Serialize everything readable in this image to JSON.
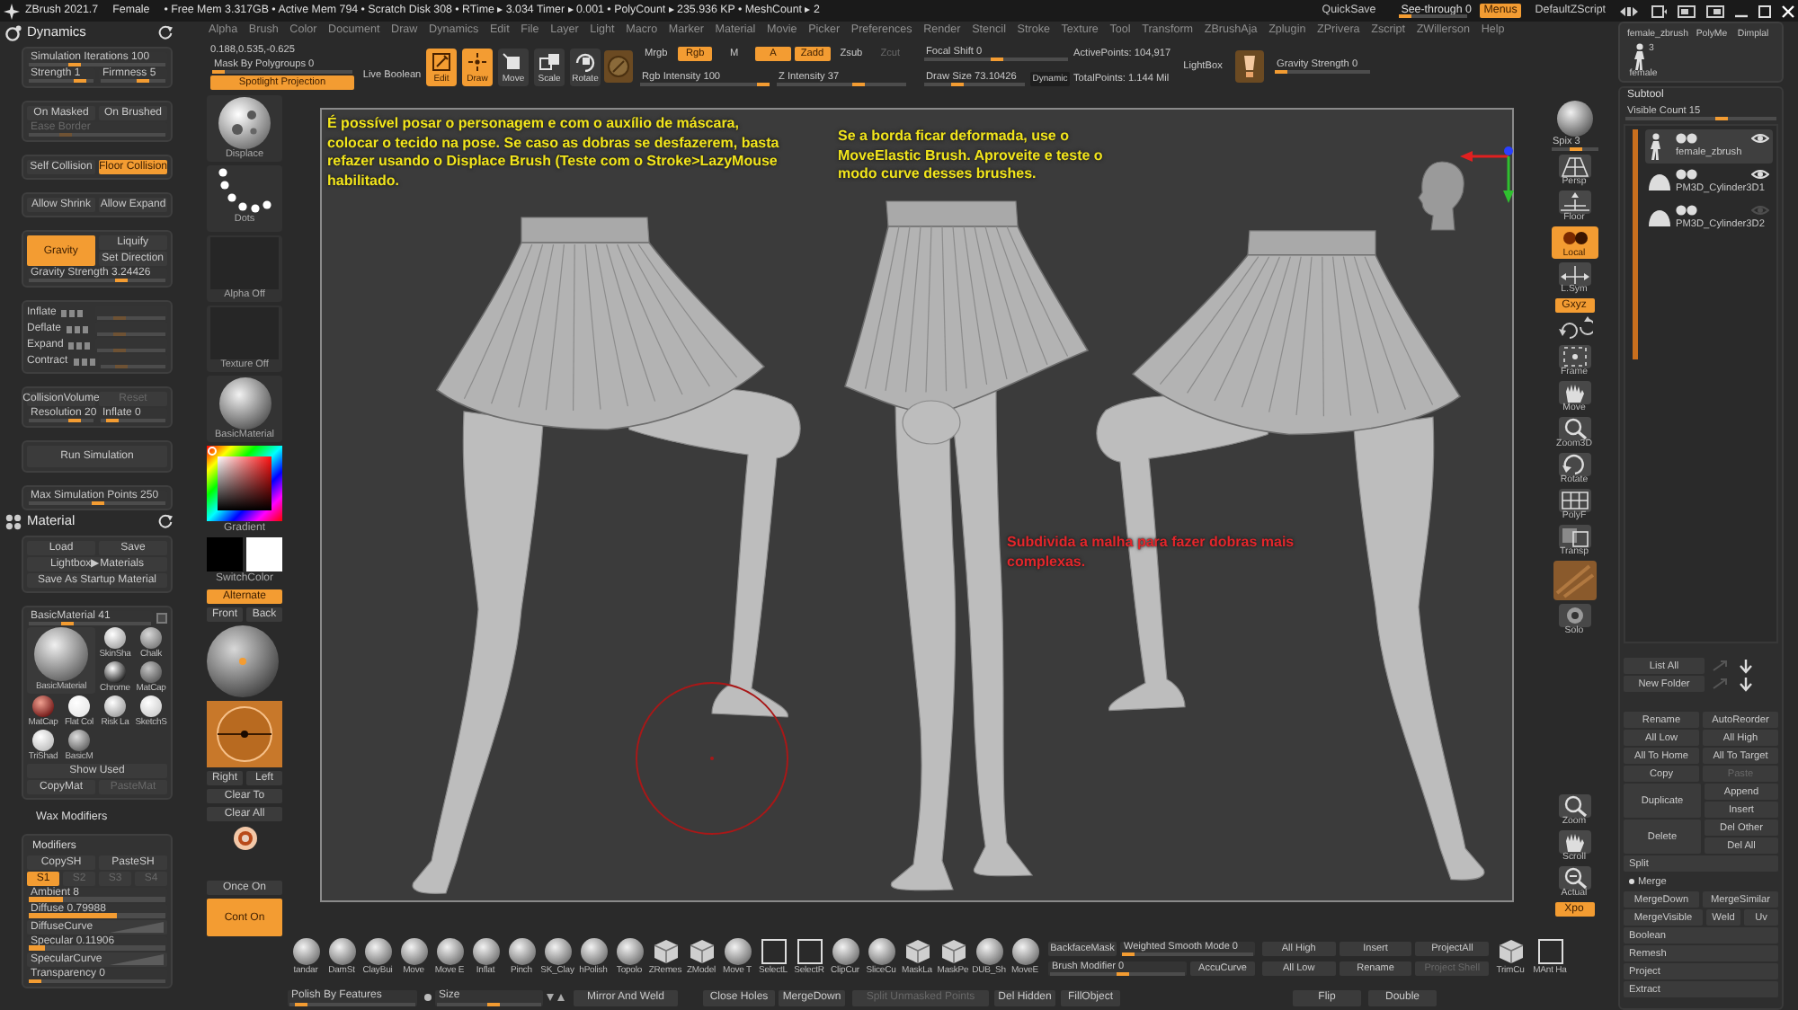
{
  "title_bar": {
    "app": "ZBrush 2021.7",
    "document": "Female",
    "stats": "• Free Mem 3.317GB • Active Mem 794 • Scratch Disk 308 • RTime ▸ 3.034 Timer ▸ 0.001 • PolyCount ▸ 235.936 KP • MeshCount ▸ 2",
    "controls": [
      {
        "kind": "button",
        "label": "QuickSave",
        "on": false
      },
      {
        "kind": "slider",
        "label": "See-through 0",
        "level": 0
      },
      {
        "kind": "button",
        "label": "Menus",
        "on": true
      },
      {
        "kind": "button",
        "label": "DefaultZScript",
        "on": false
      }
    ]
  },
  "menu": [
    "Alpha",
    "Brush",
    "Color",
    "Document",
    "Draw",
    "Dynamics",
    "Edit",
    "File",
    "Layer",
    "Light",
    "Macro",
    "Marker",
    "Material",
    "Movie",
    "Picker",
    "Preferences",
    "Render",
    "Stencil",
    "Stroke",
    "Texture",
    "Tool",
    "Transform",
    "ZBrushAja",
    "Zplugin",
    "ZPrivera",
    "Zscript",
    "ZWillerson",
    "Help"
  ],
  "toolbar": [
    {
      "kind": "stack",
      "items": [
        {
          "kind": "text",
          "label": "0.188,0.535,-0.625"
        },
        {
          "kind": "slider",
          "label": "Mask By Polygroups 0",
          "level": 0
        },
        {
          "kind": "button",
          "label": "Spotlight Projection",
          "on": true
        }
      ]
    },
    {
      "kind": "stack",
      "items": [
        {
          "kind": "button",
          "label": "Live Boolean",
          "on": false
        }
      ]
    },
    {
      "kind": "tools",
      "items": [
        {
          "label": "Edit",
          "on": true
        },
        {
          "label": "Draw",
          "on": true
        },
        {
          "label": "Move",
          "on": false
        },
        {
          "label": "Scale",
          "on": false
        },
        {
          "label": "Rotate",
          "on": false
        }
      ]
    },
    {
      "kind": "material-swatch"
    },
    {
      "kind": "stack",
      "items": [
        {
          "kind": "row",
          "items": [
            {
              "kind": "button",
              "label": "Mrgb",
              "on": false,
              "disabled": false
            },
            {
              "kind": "button",
              "label": "Rgb",
              "on": true,
              "disabled": false
            },
            {
              "kind": "button",
              "label": "M",
              "on": false,
              "disabled": false
            },
            {
              "kind": "button",
              "label": "A",
              "on": true,
              "disabled": false
            },
            {
              "kind": "button",
              "label": "Zadd",
              "on": true,
              "disabled": false
            },
            {
              "kind": "button",
              "label": "Zsub",
              "on": false,
              "disabled": false
            },
            {
              "kind": "button",
              "label": "Zcut",
              "on": false,
              "disabled": true
            }
          ]
        },
        {
          "kind": "row",
          "items": [
            {
              "kind": "slider",
              "label": "Rgb Intensity 100",
              "level": 1
            },
            {
              "kind": "slider",
              "label": "Z Intensity 37",
              "level": 0.65
            }
          ]
        }
      ]
    },
    {
      "kind": "stack",
      "items": [
        {
          "kind": "slider",
          "label": "Focal Shift 0",
          "level": 0.5
        },
        {
          "kind": "row",
          "items": [
            {
              "kind": "slider",
              "label": "Draw Size 73.10426",
              "level": 0.3
            },
            {
              "kind": "button",
              "label": "Dynamic",
              "on": false
            }
          ]
        }
      ]
    },
    {
      "kind": "stack",
      "items": [
        {
          "kind": "text",
          "label": "ActivePoints: 104,917"
        },
        {
          "kind": "text",
          "label": "TotalPoints: 1.144 Mil"
        }
      ]
    },
    {
      "kind": "button",
      "label": "LightBox",
      "on": false
    },
    {
      "kind": "light-swatch"
    },
    {
      "kind": "stack",
      "items": [
        {
          "kind": "slider",
          "label": "Gravity Strength 0",
          "level": 0
        }
      ]
    }
  ],
  "dynamics": {
    "title": "Dynamics",
    "groups": [
      [
        [
          {
            "kind": "slider",
            "label": "Simulation Iterations 100",
            "level": 0.32
          }
        ],
        [
          {
            "kind": "slider",
            "label": "Strength 1",
            "level": 0.85
          },
          {
            "kind": "slider",
            "label": "Firmness 5",
            "level": 0.7
          }
        ]
      ],
      [
        [
          {
            "kind": "button",
            "label": "On Masked",
            "on": false,
            "disabled": false
          },
          {
            "kind": "button",
            "label": "On Brushed",
            "on": false,
            "disabled": false
          }
        ],
        [
          {
            "kind": "slider",
            "label": "Ease Border",
            "level": 0.25,
            "disabled": true
          }
        ]
      ],
      [
        [
          {
            "kind": "button",
            "label": "Self Collision",
            "on": false
          },
          {
            "kind": "button",
            "label": "Floor Collision",
            "on": true
          }
        ]
      ],
      [
        [
          {
            "kind": "button",
            "label": "Allow Shrink",
            "on": false
          },
          {
            "kind": "button",
            "label": "Allow Expand",
            "on": false
          }
        ]
      ],
      [
        [
          {
            "kind": "button",
            "label": "Gravity",
            "on": true
          },
          {
            "kind": "stack",
            "items": [
              {
                "kind": "button",
                "label": "Liquify",
                "on": false
              },
              {
                "kind": "button",
                "label": "Set Direction",
                "on": false
              }
            ]
          }
        ],
        [
          {
            "kind": "slider",
            "label": "Gravity Strength 3.24426",
            "level": 0.7
          }
        ]
      ],
      [
        [
          {
            "kind": "axis",
            "label": "Inflate"
          },
          {
            "kind": "slider",
            "level": 0.3,
            "disabled": true
          }
        ],
        [
          {
            "kind": "axis",
            "label": "Deflate"
          },
          {
            "kind": "slider",
            "level": 0.3,
            "disabled": true
          }
        ],
        [
          {
            "kind": "axis",
            "label": "Expand"
          },
          {
            "kind": "slider",
            "level": 0.3,
            "disabled": true
          }
        ],
        [
          {
            "kind": "axis",
            "label": "Contract"
          },
          {
            "kind": "slider",
            "level": 0.3,
            "disabled": true
          }
        ]
      ],
      [
        [
          {
            "kind": "button",
            "label": "CollisionVolume",
            "on": false,
            "disabled": false
          },
          {
            "kind": "button",
            "label": "Reset",
            "on": false,
            "disabled": true
          }
        ],
        [
          {
            "kind": "slider",
            "label": "Resolution 20",
            "level": 0.75
          },
          {
            "kind": "slider",
            "label": "Inflate 0",
            "level": 0.12
          }
        ]
      ],
      [
        [
          {
            "kind": "button",
            "label": "Run Simulation",
            "on": false
          }
        ]
      ],
      [
        [
          {
            "kind": "slider",
            "label": "Max Simulation Points 250",
            "level": 0.5
          }
        ]
      ]
    ]
  },
  "material": {
    "title": "Material",
    "groups": [
      [
        [
          {
            "kind": "button",
            "label": "Load",
            "on": false
          },
          {
            "kind": "button",
            "label": "Save",
            "on": false
          }
        ],
        [
          {
            "kind": "button",
            "label": "Lightbox▶Materials",
            "on": false
          }
        ],
        [
          {
            "kind": "button",
            "label": "Save As Startup Material",
            "on": false
          }
        ]
      ],
      [
        [
          {
            "kind": "slider",
            "label": "BasicMaterial 41",
            "level": 0.3
          },
          {
            "kind": "corner"
          }
        ],
        [
          {
            "kind": "gallery",
            "main": "BasicMaterial",
            "thumbs": [
              "SkinSha",
              "Chalk",
              "Chrome",
              "MatCap",
              "MatCap",
              "Flat Col",
              "Risk La",
              "SketchS",
              "TriShad",
              "BasicM"
            ]
          }
        ],
        [
          {
            "kind": "button",
            "label": "Show Used",
            "on": false,
            "disabled": false
          }
        ],
        [
          {
            "kind": "button",
            "label": "CopyMat",
            "on": false,
            "disabled": false
          },
          {
            "kind": "button",
            "label": "PasteMat",
            "on": false,
            "disabled": true
          }
        ]
      ]
    ],
    "subpalette": {
      "title": "Wax Modifiers",
      "groups": [
        [
          [
            {
              "kind": "heading",
              "label": "Modifiers"
            }
          ],
          [
            {
              "kind": "button",
              "label": "CopySH",
              "on": false
            },
            {
              "kind": "button",
              "label": "PasteSH",
              "on": false
            }
          ],
          [
            {
              "kind": "button",
              "label": "S1",
              "on": true,
              "disabled": false
            },
            {
              "kind": "button",
              "label": "S2",
              "on": false,
              "disabled": true
            },
            {
              "kind": "button",
              "label": "S3",
              "on": false,
              "disabled": true
            },
            {
              "kind": "button",
              "label": "S4",
              "on": false,
              "disabled": true
            }
          ],
          [
            {
              "kind": "bar",
              "label": "Ambient 8",
              "level": 0.25
            }
          ],
          [
            {
              "kind": "bar",
              "label": "Diffuse 0.79988",
              "level": 0.65
            }
          ],
          [
            {
              "kind": "curve",
              "label": "DiffuseCurve"
            }
          ],
          [
            {
              "kind": "bar",
              "label": "Specular 0.11906",
              "level": 0.12
            }
          ],
          [
            {
              "kind": "curve",
              "label": "SpecularCurve"
            }
          ],
          [
            {
              "kind": "slider",
              "label": "Transparency 0",
              "level": 0
            }
          ]
        ]
      ]
    }
  },
  "left_shelf": [
    {
      "kind": "brush",
      "label": "Displace"
    },
    {
      "kind": "stroke",
      "label": "Dots"
    },
    {
      "kind": "alpha",
      "label": "Alpha Off"
    },
    {
      "kind": "texture",
      "label": "Texture Off"
    },
    {
      "kind": "material",
      "label": "BasicMaterial"
    },
    {
      "kind": "picker",
      "label": "Gradient"
    },
    {
      "kind": "swatches",
      "label": "SwitchColor"
    },
    {
      "kind": "button",
      "label": "Alternate",
      "on": true
    },
    {
      "kind": "row",
      "items": [
        {
          "kind": "button",
          "label": "Front",
          "on": false
        },
        {
          "kind": "button",
          "label": "Back",
          "on": false
        }
      ]
    },
    {
      "kind": "preview"
    },
    {
      "kind": "dial"
    },
    {
      "kind": "row",
      "items": [
        {
          "kind": "button",
          "label": "Right",
          "on": false
        },
        {
          "kind": "button",
          "label": "Left",
          "on": false
        }
      ]
    },
    {
      "kind": "button",
      "label": "Clear To",
      "on": false
    },
    {
      "kind": "button",
      "label": "Clear All",
      "on": false
    },
    {
      "kind": "spot"
    },
    {
      "kind": "button",
      "label": "Once On",
      "on": false
    },
    {
      "kind": "button",
      "label": "Cont On",
      "on": true
    }
  ],
  "canvas": {
    "notes": [
      {
        "text": "É possível posar o personagem e com o auxílio de máscara, colocar o tecido na pose. Se caso as dobras se desfazerem, basta refazer usando o Displace Brush (Teste com o Stroke>LazyMouse habilitado.",
        "color": "#f2e51c"
      },
      {
        "text": "Se a borda ficar deformada, use o MoveElastic Brush. Aproveite e teste o modo curve desses brushes.",
        "color": "#f2e51c"
      },
      {
        "text": "Subdivida a malha para fazer dobras mais complexas.",
        "color": "#e3262b"
      }
    ]
  },
  "right_shelf": {
    "top": [
      {
        "kind": "spix",
        "label": "Spix 3",
        "level": 0.55
      },
      {
        "kind": "tool",
        "label": "Persp",
        "on": false
      },
      {
        "kind": "tool",
        "label": "Floor",
        "on": false
      },
      {
        "kind": "tool",
        "label": "Local",
        "on": true
      },
      {
        "kind": "tool",
        "label": "L.Sym",
        "on": false
      },
      {
        "kind": "button",
        "label": "Gxyz",
        "on": true
      },
      {
        "kind": "rotate"
      },
      {
        "kind": "tool",
        "label": "Frame",
        "on": false
      },
      {
        "kind": "tool",
        "label": "Move",
        "on": false
      },
      {
        "kind": "tool",
        "label": "Zoom3D",
        "on": false
      },
      {
        "kind": "tool",
        "label": "Rotate",
        "on": false
      },
      {
        "kind": "tool",
        "label": "PolyF",
        "on": false
      },
      {
        "kind": "tool",
        "label": "Transp",
        "on": false
      },
      {
        "kind": "texture"
      },
      {
        "kind": "tool",
        "label": "Solo",
        "on": false
      }
    ],
    "bottom": [
      {
        "kind": "tool",
        "label": "Zoom",
        "on": false
      },
      {
        "kind": "tool",
        "label": "Scroll",
        "on": false
      },
      {
        "kind": "tool",
        "label": "Actual",
        "on": false
      },
      {
        "kind": "button",
        "label": "Xpo",
        "on": true
      }
    ]
  },
  "lightbox": [
    {
      "label": "female_zbrush"
    },
    {
      "label": "PolyMe"
    },
    {
      "label": "Dimplal"
    },
    {
      "label": "female",
      "count": "3"
    }
  ],
  "subtool": {
    "title": "Subtool",
    "visible_count": {
      "label": "Visible Count 15",
      "level": 0.65
    },
    "items": [
      {
        "label": "female_zbrush",
        "selected": true,
        "visible": true
      },
      {
        "label": "PM3D_Cylinder3D1",
        "selected": false,
        "visible": true
      },
      {
        "label": "PM3D_Cylinder3D2",
        "selected": false,
        "visible": false
      }
    ],
    "list_buttons": [
      {
        "label": "List All"
      },
      {
        "label": "New Folder"
      }
    ],
    "actions": [
      [
        {
          "kind": "button",
          "label": "Rename",
          "on": false
        },
        {
          "kind": "button",
          "label": "AutoReorder",
          "on": false
        }
      ],
      [
        {
          "kind": "button",
          "label": "All Low",
          "on": false
        },
        {
          "kind": "button",
          "label": "All High",
          "on": false
        }
      ],
      [
        {
          "kind": "button",
          "label": "All To Home",
          "on": false
        },
        {
          "kind": "button",
          "label": "All To Target",
          "on": false
        }
      ],
      [
        {
          "kind": "button",
          "label": "Copy",
          "on": false,
          "disabled": false
        },
        {
          "kind": "button",
          "label": "Paste",
          "on": false,
          "disabled": true
        }
      ],
      [
        {
          "kind": "button",
          "label": "Duplicate",
          "on": false
        },
        {
          "kind": "stack",
          "items": [
            {
              "kind": "button",
              "label": "Append",
              "on": false
            },
            {
              "kind": "button",
              "label": "Insert",
              "on": false
            }
          ]
        }
      ],
      [
        {
          "kind": "button",
          "label": "Delete",
          "on": false
        },
        {
          "kind": "stack",
          "items": [
            {
              "kind": "button",
              "label": "Del Other",
              "on": false
            },
            {
              "kind": "button",
              "label": "Del All",
              "on": false
            }
          ]
        }
      ],
      [
        {
          "kind": "section",
          "label": "Split",
          "expanded": false
        }
      ],
      [
        {
          "kind": "section",
          "label": "Merge",
          "expanded": true
        }
      ],
      [
        {
          "kind": "button",
          "label": "MergeDown",
          "on": false
        },
        {
          "kind": "button",
          "label": "MergeSimilar",
          "on": false
        }
      ],
      [
        {
          "kind": "button",
          "label": "MergeVisible",
          "on": false
        },
        {
          "kind": "button",
          "label": "Weld",
          "on": false
        },
        {
          "kind": "button",
          "label": "Uv",
          "on": false
        }
      ],
      [
        {
          "kind": "section",
          "label": "Boolean",
          "expanded": false
        }
      ],
      [
        {
          "kind": "section",
          "label": "Remesh",
          "expanded": false
        }
      ],
      [
        {
          "kind": "section",
          "label": "Project",
          "expanded": false
        }
      ],
      [
        {
          "kind": "section",
          "label": "Extract",
          "expanded": false
        }
      ]
    ]
  },
  "brush_shelf": {
    "brushes": [
      "tandar",
      "DamSt",
      "ClayBui",
      "Move",
      "Move E",
      "Inflat",
      "Pinch",
      "SK_Clay",
      "hPolish",
      "Topolo",
      "ZRemes",
      "ZModel",
      "Move T",
      "SelectL",
      "SelectR",
      "ClipCur",
      "SliceCu",
      "MaskLa",
      "MaskPe",
      "DUB_Sh",
      "MoveE"
    ],
    "controls": [
      [
        {
          "kind": "button",
          "label": "BackfaceMask",
          "on": false
        },
        {
          "kind": "slider",
          "label": "Weighted Smooth Mode 0",
          "level": 0
        }
      ],
      [
        {
          "kind": "slider",
          "label": "Brush Modifier 0",
          "level": 0.55
        },
        {
          "kind": "button",
          "label": "AccuCurve",
          "on": false
        }
      ]
    ],
    "actions": [
      [
        {
          "kind": "button",
          "label": "All High",
          "on": false,
          "disabled": false
        },
        {
          "kind": "button",
          "label": "Insert",
          "on": false,
          "disabled": false
        },
        {
          "kind": "button",
          "label": "ProjectAll",
          "on": false,
          "disabled": false
        }
      ],
      [
        {
          "kind": "button",
          "label": "All Low",
          "on": false,
          "disabled": false
        },
        {
          "kind": "button",
          "label": "Rename",
          "on": false,
          "disabled": false
        },
        {
          "kind": "button",
          "label": "Project Shell",
          "on": false,
          "disabled": true
        }
      ]
    ],
    "extras": [
      "TrimCu",
      "MAnt Ha"
    ]
  },
  "bottom_bar": [
    {
      "kind": "slider",
      "label": "Polish By Features",
      "level": 0.05
    },
    {
      "kind": "dot"
    },
    {
      "kind": "slider",
      "label": "Size",
      "level": 0.55
    },
    {
      "kind": "arrows"
    },
    {
      "kind": "button",
      "label": "Mirror And Weld",
      "on": false,
      "disabled": false
    },
    {
      "kind": "button",
      "label": "Close Holes",
      "on": false,
      "disabled": false
    },
    {
      "kind": "button",
      "label": "MergeDown",
      "on": false,
      "disabled": false
    },
    {
      "kind": "button",
      "label": "Split Unmasked Points",
      "on": false,
      "disabled": true
    },
    {
      "kind": "button",
      "label": "Del Hidden",
      "on": false,
      "disabled": false
    },
    {
      "kind": "button",
      "label": "FillObject",
      "on": false,
      "disabled": false
    },
    {
      "kind": "button",
      "label": "Flip",
      "on": false,
      "disabled": false
    },
    {
      "kind": "button",
      "label": "Double",
      "on": false,
      "disabled": false
    }
  ]
}
